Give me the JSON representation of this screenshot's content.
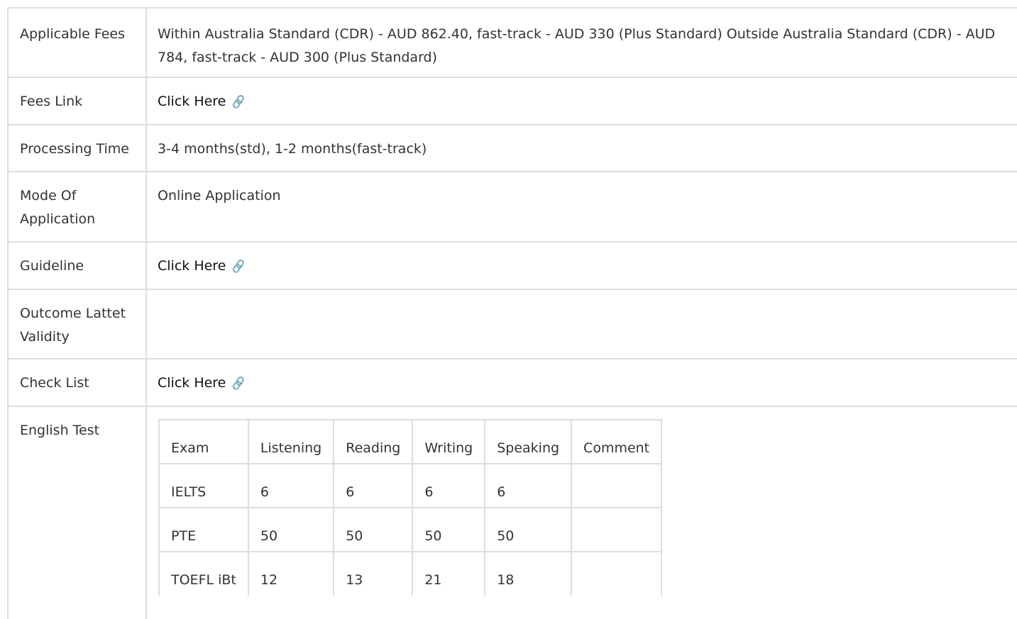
{
  "rows": {
    "fees": {
      "label": "Applicable Fees",
      "value": "Within Australia Standard (CDR) - AUD 862.40, fast-track - AUD 330 (Plus Standard) Outside Australia Standard (CDR) - AUD 784, fast-track - AUD 300 (Plus Standard)"
    },
    "fees_link": {
      "label": "Fees Link",
      "link_text": "Click Here",
      "icon": "link-icon"
    },
    "processing": {
      "label": "Processing Time",
      "value": "3-4 months(std), 1-2 months(fast-track)"
    },
    "mode": {
      "label": "Mode Of Application",
      "value": "Online Application"
    },
    "guideline": {
      "label": "Guideline",
      "link_text": "Click Here",
      "icon": "link-icon"
    },
    "outcome": {
      "label": "Outcome Lattet Validity",
      "value": ""
    },
    "checklist": {
      "label": "Check List",
      "link_text": "Click Here",
      "icon": "link-icon"
    },
    "english": {
      "label": "English Test",
      "headers": [
        "Exam",
        "Listening",
        "Reading",
        "Writing",
        "Speaking",
        "Comment"
      ],
      "rows": [
        [
          "IELTS",
          "6",
          "6",
          "6",
          "6",
          ""
        ],
        [
          "PTE",
          "50",
          "50",
          "50",
          "50",
          ""
        ],
        [
          "TOEFL iBt",
          "12",
          "13",
          "21",
          "18",
          ""
        ]
      ]
    }
  },
  "colors": {
    "border": "#dddddd",
    "text": "#333333",
    "link": "#111111"
  }
}
